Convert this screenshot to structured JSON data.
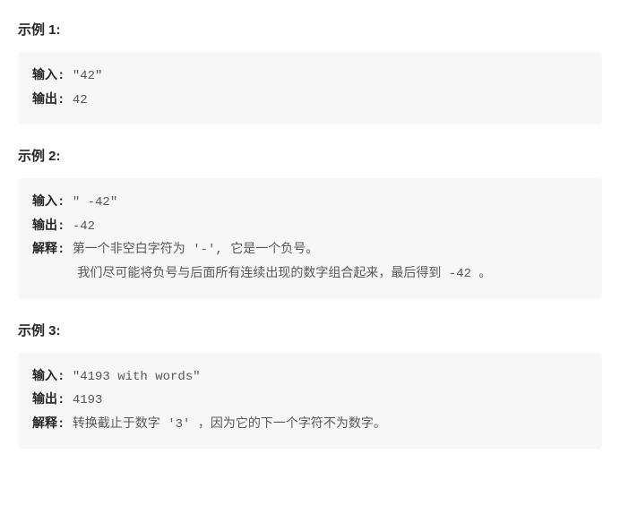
{
  "examples": [
    {
      "heading": "示例 1:",
      "input_label": "输入: ",
      "input_value": "\"42\"",
      "output_label": "输出: ",
      "output_value": "42"
    },
    {
      "heading": "示例 2:",
      "input_label": "输入: ",
      "input_value": "\"   -42\"",
      "output_label": "输出: ",
      "output_value": "-42",
      "explain_label": "解释: ",
      "explain_line1": "第一个非空白字符为 '-', 它是一个负号。",
      "explain_line2": "我们尽可能将负号与后面所有连续出现的数字组合起来，最后得到 -42 。"
    },
    {
      "heading": "示例 3:",
      "input_label": "输入: ",
      "input_value": "\"4193 with words\"",
      "output_label": "输出: ",
      "output_value": "4193",
      "explain_label": "解释: ",
      "explain_line1": "转换截止于数字 '3' ，因为它的下一个字符不为数字。"
    }
  ]
}
